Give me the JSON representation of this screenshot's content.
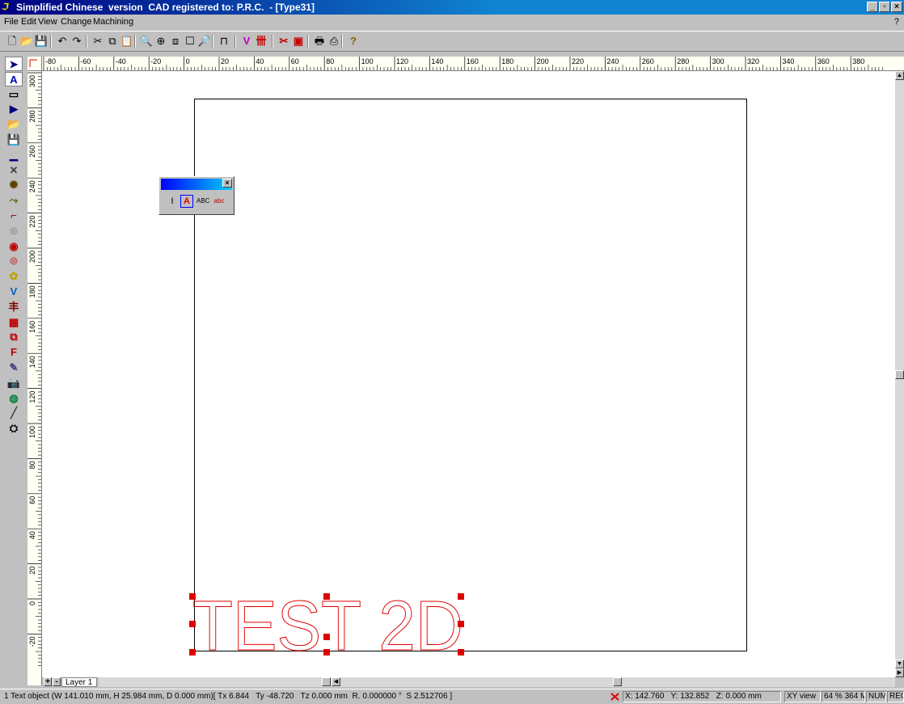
{
  "window": {
    "title": "Simplified Chinese  version  CAD registered to: P.R.C.  - [Type31]",
    "app_icon": "cad-app-icon",
    "controls": {
      "minimize": "_",
      "restore": "▫",
      "close": "×"
    }
  },
  "menu": {
    "items": [
      "File",
      "Edit",
      "View",
      "Change",
      "Machining"
    ],
    "help": "?"
  },
  "toolbar": {
    "buttons": [
      {
        "name": "new-file-icon",
        "glyph": "🗋"
      },
      {
        "name": "open-file-icon",
        "glyph": "📂"
      },
      {
        "name": "save-icon",
        "glyph": "💾"
      },
      {
        "name": "undo-icon",
        "glyph": "↶"
      },
      {
        "name": "redo-icon",
        "glyph": "↷"
      },
      {
        "name": "cut-icon",
        "glyph": "✂"
      },
      {
        "name": "copy-icon",
        "glyph": "⧉"
      },
      {
        "name": "paste-icon",
        "glyph": "📋"
      },
      {
        "name": "zoom-icon",
        "glyph": "🔍"
      },
      {
        "name": "zoom-in-icon",
        "glyph": "⊕"
      },
      {
        "name": "zoom-window-icon",
        "glyph": "⧈"
      },
      {
        "name": "zoom-page-icon",
        "glyph": "☐"
      },
      {
        "name": "zoom-all-icon",
        "glyph": "🔎"
      },
      {
        "name": "measure-icon",
        "glyph": "⊓"
      },
      {
        "name": "vcarve-icon",
        "glyph": "V"
      },
      {
        "name": "engrave-icon",
        "glyph": "卌"
      },
      {
        "name": "toolpath-icon",
        "glyph": "✂"
      },
      {
        "name": "simulate-icon",
        "glyph": "▣"
      },
      {
        "name": "print-icon",
        "glyph": "🖶"
      },
      {
        "name": "print-preview-icon",
        "glyph": "⎙"
      },
      {
        "name": "help-icon",
        "glyph": "?"
      }
    ]
  },
  "left_tools": [
    {
      "name": "select-arrow-icon",
      "glyph": "➤"
    },
    {
      "name": "text-tool-icon",
      "glyph": "A"
    },
    {
      "name": "rectangle-tool-icon",
      "glyph": "▭"
    },
    {
      "name": "node-edit-icon",
      "glyph": "▶"
    },
    {
      "name": "import-icon",
      "glyph": "📂"
    },
    {
      "name": "save-drawing-icon",
      "glyph": "💾"
    },
    {
      "name": "line-tool-icon",
      "glyph": "▁"
    },
    {
      "name": "trace-icon",
      "glyph": "✕"
    },
    {
      "name": "weld-icon",
      "glyph": "✺"
    },
    {
      "name": "offset-icon",
      "glyph": "⤳"
    },
    {
      "name": "fillet-icon",
      "glyph": "⌐"
    },
    {
      "name": "array-icon",
      "glyph": "⊛"
    },
    {
      "name": "mirror-icon",
      "glyph": "◉"
    },
    {
      "name": "rotate-icon",
      "glyph": "⊜"
    },
    {
      "name": "palette-icon",
      "glyph": "✿"
    },
    {
      "name": "vbit-icon",
      "glyph": "V"
    },
    {
      "name": "align-icon",
      "glyph": "丰"
    },
    {
      "name": "grid-icon",
      "glyph": "▦"
    },
    {
      "name": "frame-icon",
      "glyph": "⧉"
    },
    {
      "name": "font-icon",
      "glyph": "F"
    },
    {
      "name": "sketch-icon",
      "glyph": "✎"
    },
    {
      "name": "camera-icon",
      "glyph": "📷"
    },
    {
      "name": "3d-icon",
      "glyph": "◍"
    },
    {
      "name": "knife-icon",
      "glyph": "╱"
    },
    {
      "name": "machine-icon",
      "glyph": "⛭"
    }
  ],
  "rulers": {
    "horizontal_labels": [
      "80",
      "60",
      "40",
      "20",
      "0",
      "20",
      "40",
      "60",
      "80",
      "100",
      "120",
      "140",
      "160",
      "180",
      "200",
      "220",
      "240",
      "260",
      "280",
      "300",
      "320",
      "340",
      "360",
      "380"
    ],
    "horizontal_signs": [
      "-",
      "-",
      "-",
      "-",
      "",
      "",
      "",
      "",
      "",
      "",
      "",
      "",
      "",
      "",
      "",
      "",
      "",
      "",
      "",
      "",
      "",
      "",
      "",
      ""
    ],
    "vertical_labels": [
      "300",
      "280",
      "260",
      "240",
      "220",
      "200",
      "180",
      "160",
      "140",
      "120",
      "100",
      "80",
      "60",
      "40",
      "20",
      "0",
      "20"
    ],
    "vertical_signs": [
      "",
      "",
      "",
      "",
      "",
      "",
      "",
      "",
      "",
      "",
      "",
      "",
      "",
      "",
      "",
      "",
      "-"
    ]
  },
  "palette": {
    "tools": [
      {
        "name": "text-cursor-icon",
        "glyph": "I"
      },
      {
        "name": "text-frame-icon",
        "glyph": "A"
      },
      {
        "name": "text-on-path-icon",
        "glyph": "ABC"
      },
      {
        "name": "text-edit-icon",
        "glyph": "abc"
      }
    ],
    "close": "×"
  },
  "drawing": {
    "text": "TEST 2D",
    "stroke_color": "#e00000"
  },
  "layer_bar": {
    "add": "+",
    "remove": "-",
    "tab": "Layer 1"
  },
  "status": {
    "selection_info": "1 Text object (W 141.010 mm, H 25.984 mm, D 0.000 mm)[ Tx 6.844   Ty -48.720   Tz 0.000 mm  R. 0.000000 °  S 2.512706 ]",
    "coordinates": "X: 142.760   Y: 132.852   Z: 0.000 mm",
    "view": "XY view",
    "zoom": "64 % 364 M",
    "num": "NUM",
    "rec": "REC"
  }
}
